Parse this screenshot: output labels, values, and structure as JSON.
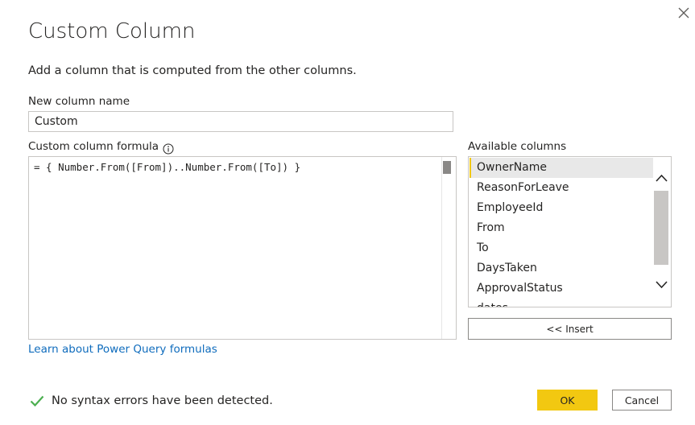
{
  "dialog": {
    "title": "Custom Column",
    "description": "Add a column that is computed from the other columns."
  },
  "new_column": {
    "label": "New column name",
    "value": "Custom"
  },
  "formula": {
    "label": "Custom column formula",
    "info_icon": "info-icon",
    "value": "= { Number.From([From])..Number.From([To]) }"
  },
  "available_columns": {
    "label": "Available columns",
    "items": [
      "OwnerName",
      "ReasonForLeave",
      "EmployeeId",
      "From",
      "To",
      "DaysTaken",
      "ApprovalStatus",
      "dates"
    ],
    "selected": "OwnerName",
    "insert_label": "<< Insert"
  },
  "learn_link": "Learn about Power Query formulas",
  "status": {
    "icon": "check-icon",
    "text": "No syntax errors have been detected."
  },
  "buttons": {
    "ok": "OK",
    "cancel": "Cancel"
  },
  "colors": {
    "accent": "#f2c811",
    "link": "#0f6cbd",
    "success": "#4caf50"
  }
}
